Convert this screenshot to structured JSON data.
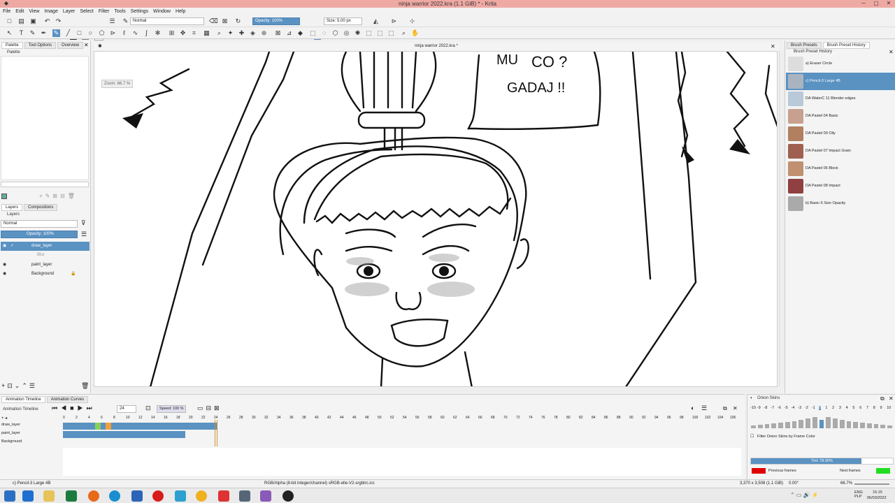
{
  "window": {
    "title": "ninja warrior 2022.kra (1.1 GiB)  * - Krita"
  },
  "menu": [
    "File",
    "Edit",
    "View",
    "Image",
    "Layer",
    "Select",
    "Filter",
    "Tools",
    "Settings",
    "Window",
    "Help"
  ],
  "toolbar": {
    "blend_mode": "Normal",
    "opacity": "Opacity: 100%",
    "size": "Size: 5.00 px"
  },
  "left_dock": {
    "tabs": [
      "Palette",
      "Tool Options",
      "Overview"
    ],
    "palette_title": "Palette",
    "layer_tabs": [
      "Layers",
      "Compositions"
    ],
    "layers_title": "Layers",
    "blend_mode": "Normal",
    "opacity": "Opacity: 100%",
    "layers": [
      {
        "name": "draw_layer"
      },
      {
        "name": "Blur"
      },
      {
        "name": "paint_layer"
      },
      {
        "name": "Background"
      }
    ]
  },
  "canvas": {
    "doc_title": "ninja warrior 2022.kra *",
    "zoom": "Zoom: 66.7 %",
    "bubble_text_1": "CO ?",
    "bubble_text_2": "GADAJ !!",
    "bubble_text_0": "MU"
  },
  "right_dock": {
    "tabs": [
      "Brush Presets",
      "Brush Preset History"
    ],
    "title": "Brush Preset History",
    "presets": [
      {
        "name": "a) Eraser Circle",
        "color": "#dddddd"
      },
      {
        "name": "c) Pencil-3 Large 4B",
        "color": "#aab4c0"
      },
      {
        "name": "DA WaterC 11 Blender edges",
        "color": "#b9c9d8"
      },
      {
        "name": "DA Pastel 04 Basic",
        "color": "#c8a090"
      },
      {
        "name": "DA Pastel 09 Oily",
        "color": "#b08060"
      },
      {
        "name": "DA Pastel 07 Impact Grain",
        "color": "#a06050"
      },
      {
        "name": "DA Pastel 06 Block",
        "color": "#c09070"
      },
      {
        "name": "DA Pastel 08 Impact",
        "color": "#904040"
      },
      {
        "name": "b) Basic-5 Size Opacity",
        "color": "#aaaaaa"
      }
    ]
  },
  "anim": {
    "tabs": [
      "Animation Timeline",
      "Animation Curves"
    ],
    "title": "Animation Timeline",
    "frame": "24",
    "speed": "Speed: 100 %",
    "frame_numbers": [
      "0",
      "2",
      "4",
      "6",
      "8",
      "10",
      "12",
      "14",
      "16",
      "18",
      "20",
      "22",
      "24",
      "26",
      "28",
      "30",
      "32",
      "34",
      "36",
      "38",
      "40",
      "42",
      "44",
      "46",
      "48",
      "50",
      "52",
      "54",
      "56",
      "58",
      "60",
      "62",
      "64",
      "66",
      "68",
      "70",
      "72",
      "74",
      "76",
      "78",
      "80",
      "82",
      "84",
      "86",
      "88",
      "90",
      "92",
      "94",
      "96",
      "98",
      "100",
      "102",
      "104",
      "106"
    ],
    "layers": [
      "draw_layer",
      "paint_layer",
      "Background"
    ]
  },
  "onion": {
    "title": "Onion Skins",
    "numbers": [
      "-10",
      "-9",
      "-8",
      "-7",
      "-6",
      "-5",
      "-4",
      "-3",
      "-2",
      "-1",
      "0",
      "1",
      "2",
      "3",
      "4",
      "5",
      "6",
      "7",
      "8",
      "9",
      "10"
    ],
    "bar_levels": [
      0.2,
      0.25,
      0.3,
      0.35,
      0.4,
      0.45,
      0.5,
      0.6,
      0.7,
      0.8,
      0.6,
      0.8,
      0.7,
      0.6,
      0.5,
      0.45,
      0.4,
      0.35,
      0.3,
      0.25,
      0.2
    ],
    "filter_label": "Filter Onion Skins by Frame Color",
    "tint": "Tint: 78.00%",
    "tint_level": 0.78,
    "prev_label": "Previous frames",
    "next_label": "Next frames",
    "prev_color": "#e00000",
    "next_color": "#22dd22"
  },
  "status": {
    "brush": "c) Pencil-3 Large 4B",
    "color_space": "RGB/Alpha (8-bit integer/channel)  sRGB-elle-V2-srgbtrc.icc",
    "dims": "3,370 x 3,508 (1.1 GiB)",
    "rotation": "0.00°",
    "zoom": "66.7%"
  },
  "taskbar": {
    "lang": "ENG\nPLP",
    "time": "15:15",
    "date": "06/03/2022"
  }
}
